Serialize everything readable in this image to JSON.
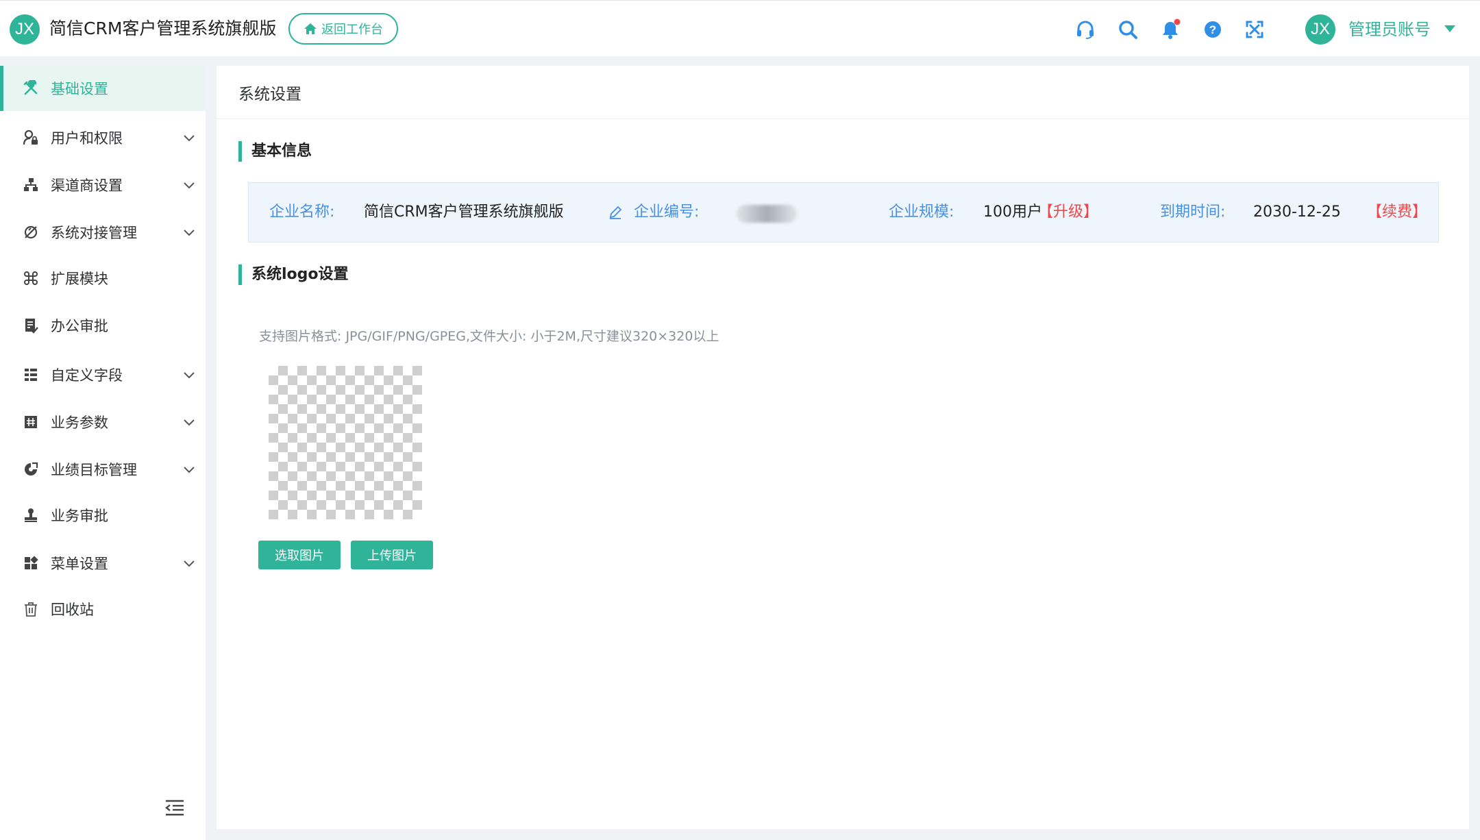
{
  "header": {
    "logo_text": "JX",
    "app_title": "简信CRM客户管理系统旗舰版",
    "back_button": "返回工作台",
    "user_avatar": "JX",
    "user_name": "管理员账号"
  },
  "sidebar": {
    "items": [
      {
        "label": "基础设置",
        "icon": "tools-icon",
        "active": true,
        "expandable": false
      },
      {
        "label": "用户和权限",
        "icon": "user-lock-icon",
        "active": false,
        "expandable": true
      },
      {
        "label": "渠道商设置",
        "icon": "org-chart-icon",
        "active": false,
        "expandable": true
      },
      {
        "label": "系统对接管理",
        "icon": "plug-icon",
        "active": false,
        "expandable": true
      },
      {
        "label": "扩展模块",
        "icon": "command-icon",
        "active": false,
        "expandable": false
      },
      {
        "label": "办公审批",
        "icon": "document-approve-icon",
        "active": false,
        "expandable": false
      },
      {
        "label": "自定义字段",
        "icon": "list-icon",
        "active": false,
        "expandable": true
      },
      {
        "label": "业务参数",
        "icon": "grid-icon",
        "active": false,
        "expandable": true
      },
      {
        "label": "业绩目标管理",
        "icon": "target-icon",
        "active": false,
        "expandable": true
      },
      {
        "label": "业务审批",
        "icon": "stamp-icon",
        "active": false,
        "expandable": false
      },
      {
        "label": "菜单设置",
        "icon": "apps-icon",
        "active": false,
        "expandable": true
      },
      {
        "label": "回收站",
        "icon": "trash-icon",
        "active": false,
        "expandable": false
      }
    ]
  },
  "main": {
    "title": "系统设置",
    "basic_info": {
      "section_title": "基本信息",
      "company_name_label": "企业名称:",
      "company_name": "简信CRM客户管理系统旗舰版",
      "company_code_label": "企业编号:",
      "company_scale_label": "企业规模:",
      "company_scale": "100用户",
      "upgrade": "【升级】",
      "expire_label": "到期时间:",
      "expire_date": "2030-12-25",
      "renew": "【续费】"
    },
    "logo": {
      "section_title": "系统logo设置",
      "hint": "支持图片格式: JPG/GIF/PNG/GPEG,文件大小: 小于2M,尺寸建议320×320以上",
      "select_button": "选取图片",
      "upload_button": "上传图片"
    }
  },
  "colors": {
    "accent": "#2fb49a",
    "link_blue": "#4a8fe0",
    "danger": "#f04848",
    "notify_dot": "#f04848"
  }
}
